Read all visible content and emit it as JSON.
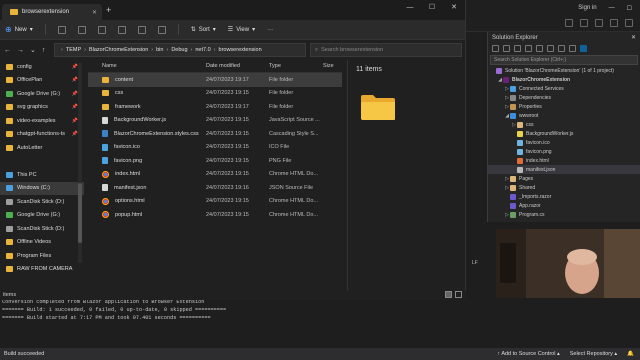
{
  "vs": {
    "signin": "Sign in",
    "left_labels": [
      "LF"
    ],
    "solution_explorer": {
      "title": "Solution Explorer",
      "search_placeholder": "Search Solution Explorer (Ctrl+;)",
      "tree": [
        {
          "label": "Solution 'BlazorChromeExtension' (1 of 1 project)",
          "indent": 0,
          "icon": "solution-icon",
          "arrow": "",
          "selected": false
        },
        {
          "label": "BlazorChromeExtension",
          "indent": 1,
          "icon": "project-icon",
          "arrow": "◢",
          "selected": false
        },
        {
          "label": "Connected Services",
          "indent": 2,
          "icon": "connected-services-icon",
          "arrow": "▷",
          "selected": false
        },
        {
          "label": "Dependencies",
          "indent": 2,
          "icon": "dependencies-icon",
          "arrow": "▷",
          "selected": false
        },
        {
          "label": "Properties",
          "indent": 2,
          "icon": "properties-icon",
          "arrow": "▷",
          "selected": false
        },
        {
          "label": "wwwroot",
          "indent": 2,
          "icon": "globe-icon",
          "arrow": "◢",
          "selected": false
        },
        {
          "label": "css",
          "indent": 3,
          "icon": "folder-icon",
          "arrow": "▷",
          "selected": false
        },
        {
          "label": "BackgroundWorker.js",
          "indent": 3,
          "icon": "js-file-icon",
          "arrow": "",
          "selected": false
        },
        {
          "label": "favicon.ico",
          "indent": 3,
          "icon": "image-file-icon",
          "arrow": "",
          "selected": false
        },
        {
          "label": "favicon.png",
          "indent": 3,
          "icon": "image-file-icon",
          "arrow": "",
          "selected": false
        },
        {
          "label": "index.html",
          "indent": 3,
          "icon": "html-file-icon",
          "arrow": "",
          "selected": false
        },
        {
          "label": "manifest.json",
          "indent": 3,
          "icon": "json-file-icon",
          "arrow": "",
          "selected": true
        },
        {
          "label": "Pages",
          "indent": 2,
          "icon": "folder-icon",
          "arrow": "▷",
          "selected": false
        },
        {
          "label": "Shared",
          "indent": 2,
          "icon": "folder-icon",
          "arrow": "▷",
          "selected": false
        },
        {
          "label": "_Imports.razor",
          "indent": 2,
          "icon": "razor-file-icon",
          "arrow": "",
          "selected": false
        },
        {
          "label": "App.razor",
          "indent": 2,
          "icon": "razor-file-icon",
          "arrow": "",
          "selected": false
        },
        {
          "label": "Program.cs",
          "indent": 2,
          "icon": "cs-file-icon",
          "arrow": "▷",
          "selected": false
        }
      ]
    },
    "output": {
      "items_tab": "items",
      "lines": [
        "Conversion completed from Blazor application to Browser Extension",
        "======= Build: 1 succeeded, 0 failed, 0 up-to-date, 0 skipped ==========",
        "======= Build started at 7:17 PM and took 07.401 seconds =========="
      ]
    },
    "status": {
      "left": "Build succeeded",
      "add_source_control": "↑ Add to Source Control ▴",
      "select_repository": "Select Repository ▴"
    }
  },
  "explorer": {
    "tab_title": "browserextension",
    "new_tab": "+",
    "win_buttons": [
      "—",
      "☐",
      "✕"
    ],
    "command_bar": {
      "new_label": "New",
      "sort_label": "Sort",
      "view_label": "View",
      "more_label": "···"
    },
    "address": {
      "crumbs": [
        "TEMP",
        "BlazorChromeExtension",
        "bin",
        "Debug",
        "net7.0",
        "browserextension"
      ],
      "search_placeholder": "Search browserextension"
    },
    "nav": [
      {
        "label": "config",
        "icon": "folder-icon",
        "color": "#e8b43c",
        "pinned": true,
        "selected": false
      },
      {
        "label": "OfficePlan",
        "icon": "folder-icon",
        "color": "#e8b43c",
        "pinned": true,
        "selected": false
      },
      {
        "label": "Google Drive (G:)",
        "icon": "drive-icon",
        "color": "#4caf50",
        "pinned": true,
        "selected": false
      },
      {
        "label": "svg graphics",
        "icon": "folder-icon",
        "color": "#e8b43c",
        "pinned": true,
        "selected": false
      },
      {
        "label": "video-examples",
        "icon": "folder-icon",
        "color": "#e8b43c",
        "pinned": true,
        "selected": false
      },
      {
        "label": "chatgpt-functions-ts",
        "icon": "folder-icon",
        "color": "#e8b43c",
        "pinned": true,
        "selected": false
      },
      {
        "label": "AutoLetter",
        "icon": "folder-icon",
        "color": "#e8b43c",
        "pinned": false,
        "selected": false
      },
      {
        "label": "",
        "icon": "",
        "color": "",
        "pinned": false,
        "selected": false
      },
      {
        "label": "This PC",
        "icon": "pc-icon",
        "color": "#4a9fe0",
        "pinned": false,
        "selected": false
      },
      {
        "label": "Windows (C:)",
        "icon": "drive-icon",
        "color": "#4a9fe0",
        "pinned": false,
        "selected": true
      },
      {
        "label": "ScanDisk Stick (D:)",
        "icon": "drive-icon",
        "color": "#9e9e9e",
        "pinned": false,
        "selected": false
      },
      {
        "label": "Google Drive (G:)",
        "icon": "drive-icon",
        "color": "#4caf50",
        "pinned": false,
        "selected": false
      },
      {
        "label": "ScanDisk Stick (D:)",
        "icon": "drive-icon",
        "color": "#9e9e9e",
        "pinned": false,
        "selected": false
      },
      {
        "label": "Offline Videos",
        "icon": "folder-icon",
        "color": "#e8b43c",
        "pinned": false,
        "selected": false
      },
      {
        "label": "Program Files",
        "icon": "folder-icon",
        "color": "#e8b43c",
        "pinned": false,
        "selected": false
      },
      {
        "label": "RAW FROM CAMERA",
        "icon": "folder-icon",
        "color": "#e8b43c",
        "pinned": false,
        "selected": false
      }
    ],
    "columns": {
      "name": "Name",
      "date": "Date modified",
      "type": "Type",
      "size": "Size"
    },
    "files": [
      {
        "name": "content",
        "date": "24/07/2023 19:17",
        "type": "File folder",
        "icon": "folder",
        "selected": true
      },
      {
        "name": "css",
        "date": "24/07/2023 19:15",
        "type": "File folder",
        "icon": "folder",
        "selected": false
      },
      {
        "name": "framework",
        "date": "24/07/2023 19:17",
        "type": "File folder",
        "icon": "folder",
        "selected": false
      },
      {
        "name": "BackgroundWorker.js",
        "date": "24/07/2023 19:15",
        "type": "JavaScript Source ...",
        "icon": "file",
        "selected": false
      },
      {
        "name": "BlazorChromeExtension.styles.css",
        "date": "24/07/2023 19:15",
        "type": "Cascading Style S...",
        "icon": "css",
        "selected": false
      },
      {
        "name": "favicon.ico",
        "date": "24/07/2023 19:15",
        "type": "ICO File",
        "icon": "img",
        "selected": false
      },
      {
        "name": "favicon.png",
        "date": "24/07/2023 19:15",
        "type": "PNG File",
        "icon": "img",
        "selected": false
      },
      {
        "name": "index.html",
        "date": "24/07/2023 19:15",
        "type": "Chrome HTML Do...",
        "icon": "chrome",
        "selected": false
      },
      {
        "name": "manifest.json",
        "date": "24/07/2023 19:16",
        "type": "JSON Source File",
        "icon": "file",
        "selected": false
      },
      {
        "name": "options.html",
        "date": "24/07/2023 19:15",
        "type": "Chrome HTML Do...",
        "icon": "chrome",
        "selected": false
      },
      {
        "name": "popup.html",
        "date": "24/07/2023 19:15",
        "type": "Chrome HTML Do...",
        "icon": "chrome",
        "selected": false
      }
    ],
    "preview_count": "11 items",
    "status_items": "items"
  }
}
